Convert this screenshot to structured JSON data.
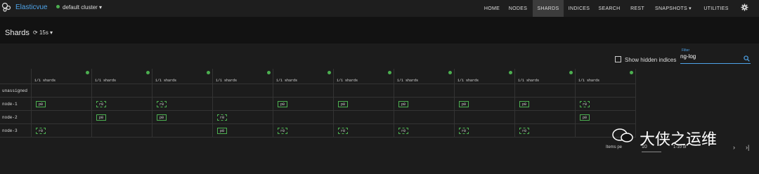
{
  "app": {
    "name": "Elasticvue",
    "cluster": "default cluster"
  },
  "nav": [
    "HOME",
    "NODES",
    "SHARDS",
    "INDICES",
    "SEARCH",
    "REST",
    "SNAPSHOTS ▾",
    "UTILITIES"
  ],
  "page": {
    "title": "Shards",
    "refresh": "15s ▾"
  },
  "controls": {
    "show_hidden": "Show hidden indices",
    "filter_label": "Filter",
    "filter_value": "ng-log"
  },
  "columns": [
    "",
    "",
    "",
    "",
    "",
    "",
    "",
    "",
    "",
    ""
  ],
  "shards_text": "1/1 shards",
  "rows": [
    {
      "label": "unassigned",
      "shards": [
        "",
        "",
        "",
        "",
        "",
        "",
        "",
        "",
        "",
        ""
      ]
    },
    {
      "label": "node-1",
      "shards": [
        "p0",
        "r0",
        "r0",
        "",
        "p0",
        "p0",
        "p0",
        "p0",
        "p0",
        "r0"
      ]
    },
    {
      "label": "node-2",
      "shards": [
        "",
        "p0",
        "p0",
        "r0",
        "",
        "",
        "",
        "",
        "",
        "p0"
      ]
    },
    {
      "label": "node-3",
      "shards": [
        "r0",
        "",
        "",
        "p0",
        "r0",
        "r0",
        "r0",
        "r0",
        "r0",
        ""
      ]
    }
  ],
  "footer": {
    "items_label": "Items pe",
    "per_page": "10",
    "range": "1-10 of",
    "prev": "‹",
    "next": "›",
    "last": "›|"
  },
  "watermark": "大侠之运维",
  "colors": {
    "accent": "#4ea3e8",
    "health": "#4caf50",
    "active_tab": "#3c3c3c"
  }
}
